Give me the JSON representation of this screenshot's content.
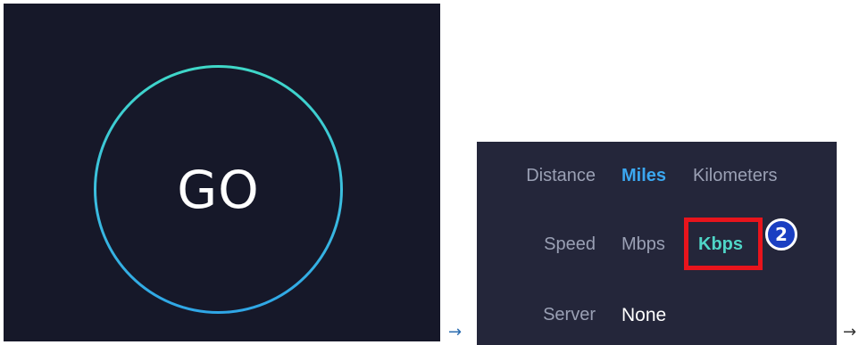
{
  "go_panel": {
    "button_label": "GO",
    "ring_colors": [
      "#3fd8c8",
      "#2fa6e6"
    ],
    "background": "#161829"
  },
  "settings": {
    "distance": {
      "label": "Distance",
      "options": [
        "Miles",
        "Kilometers"
      ],
      "selected": "Miles"
    },
    "speed": {
      "label": "Speed",
      "options": [
        "Mbps",
        "Kbps"
      ],
      "selected": "Kbps"
    },
    "server": {
      "label": "Server",
      "value": "None"
    },
    "accent_color": "#3ba7f0",
    "selected_speed_color": "#4fd6c7"
  },
  "annotation": {
    "step_number": "2",
    "highlight_color": "#e8141c"
  },
  "arrows": {
    "first": "→",
    "second": "→"
  }
}
